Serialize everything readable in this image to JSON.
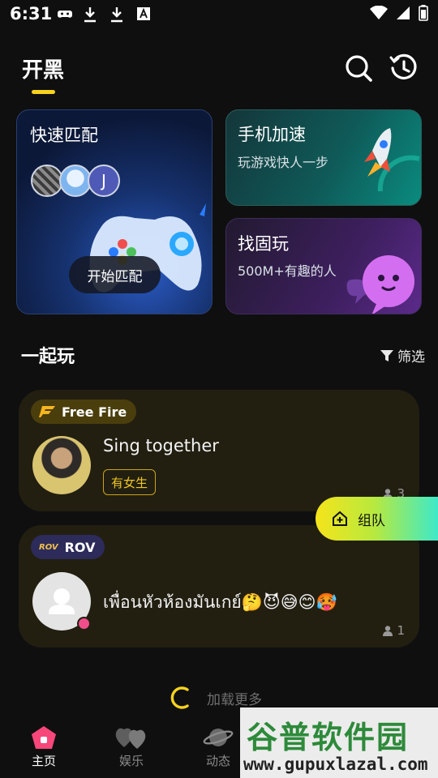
{
  "status_bar": {
    "time": "6:31",
    "left_icons": [
      "game-controller-icon",
      "download-icon",
      "download-icon",
      "font-a-icon"
    ],
    "right_icons": [
      "wifi-icon",
      "signal-icon",
      "battery-icon"
    ]
  },
  "header": {
    "title": "开黑",
    "actions": [
      "search-icon",
      "history-icon"
    ],
    "accent_color": "#f7d21e"
  },
  "feature_cards": {
    "quick_match": {
      "title": "快速匹配",
      "avatar_letter": "J",
      "button_label": "开始匹配"
    },
    "speed_boost": {
      "title": "手机加速",
      "subtitle": "玩游戏快人一步"
    },
    "find_partner": {
      "title": "找固玩",
      "subtitle": "500M+有趣的人"
    }
  },
  "section": {
    "title": "一起玩",
    "filter_label": "筛选"
  },
  "rooms": [
    {
      "game": "Free Fire",
      "title": "Sing together",
      "badge": "有女生",
      "members": "3"
    },
    {
      "game": "ROV",
      "game_icon_text": "ROV",
      "title": "เพื่อนหัวห้องมันเกย์🤔😈😅😊🥵",
      "members": "1"
    }
  ],
  "fab": {
    "label": "组队"
  },
  "load_more": "加载更多",
  "bottom_nav": [
    {
      "label": "主页",
      "icon": "home-icon",
      "active": true
    },
    {
      "label": "娱乐",
      "icon": "hearts-icon",
      "active": false
    },
    {
      "label": "动态",
      "icon": "planet-icon",
      "active": false
    }
  ],
  "watermark": {
    "main": "谷普软件园",
    "url": "www.gupuxlazal.com"
  }
}
